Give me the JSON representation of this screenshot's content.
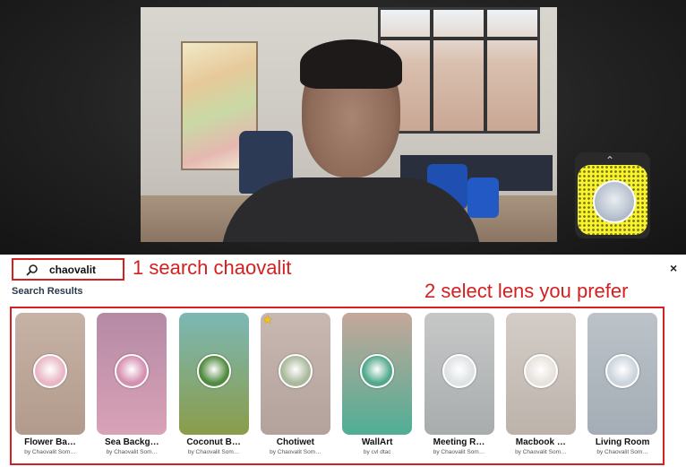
{
  "search": {
    "value": "chaovalit",
    "icon": "search-icon"
  },
  "annotations": {
    "step1": "1 search chaovalit",
    "step2": "2 select lens you prefer"
  },
  "close": {
    "label": "×",
    "icon": "close-icon"
  },
  "results": {
    "title": "Search Results",
    "lenses": [
      {
        "name": "Flower Ba…",
        "author": "by Chaovalit Som…",
        "colors": [
          "#c6b2a6",
          "#b29b8c"
        ],
        "icon_color": "#e8b7c4",
        "starred": false
      },
      {
        "name": "Sea Backg…",
        "author": "by Chaovalit Som…",
        "colors": [
          "#b58aa5",
          "#d9a2b7"
        ],
        "icon_color": "#d58fb0",
        "starred": false
      },
      {
        "name": "Coconut B…",
        "author": "by Chaovalit Som…",
        "colors": [
          "#7bb8b5",
          "#8b9c4a"
        ],
        "icon_color": "#4f8a3e",
        "starred": false
      },
      {
        "name": "Chotiwet",
        "author": "by Chaovalit Som…",
        "colors": [
          "#c9b8b2",
          "#b3a29c"
        ],
        "icon_color": "#a9b89a",
        "starred": true
      },
      {
        "name": "WallArt",
        "author": "by cvl dtac",
        "colors": [
          "#c5a79a",
          "#4fae95"
        ],
        "icon_color": "#52a88c",
        "starred": false
      },
      {
        "name": "Meeting R…",
        "author": "by Chaovalit Som…",
        "colors": [
          "#c6c8c8",
          "#a9acad"
        ],
        "icon_color": "#dfe3e6",
        "starred": false
      },
      {
        "name": "Macbook …",
        "author": "by Chaovalit Som…",
        "colors": [
          "#d4cdc7",
          "#bcb3ab"
        ],
        "icon_color": "#e7e2dc",
        "starred": false
      },
      {
        "name": "Living Room",
        "author": "by Chaovalit Som…",
        "colors": [
          "#bcc3c9",
          "#a4adb5"
        ],
        "icon_color": "#cbd4dc",
        "starred": false
      }
    ]
  },
  "snapcode": {
    "icon": "chevron-up-icon"
  },
  "colors": {
    "annotation_red": "#d32020",
    "snapcode_yellow": "#f8f32b"
  }
}
